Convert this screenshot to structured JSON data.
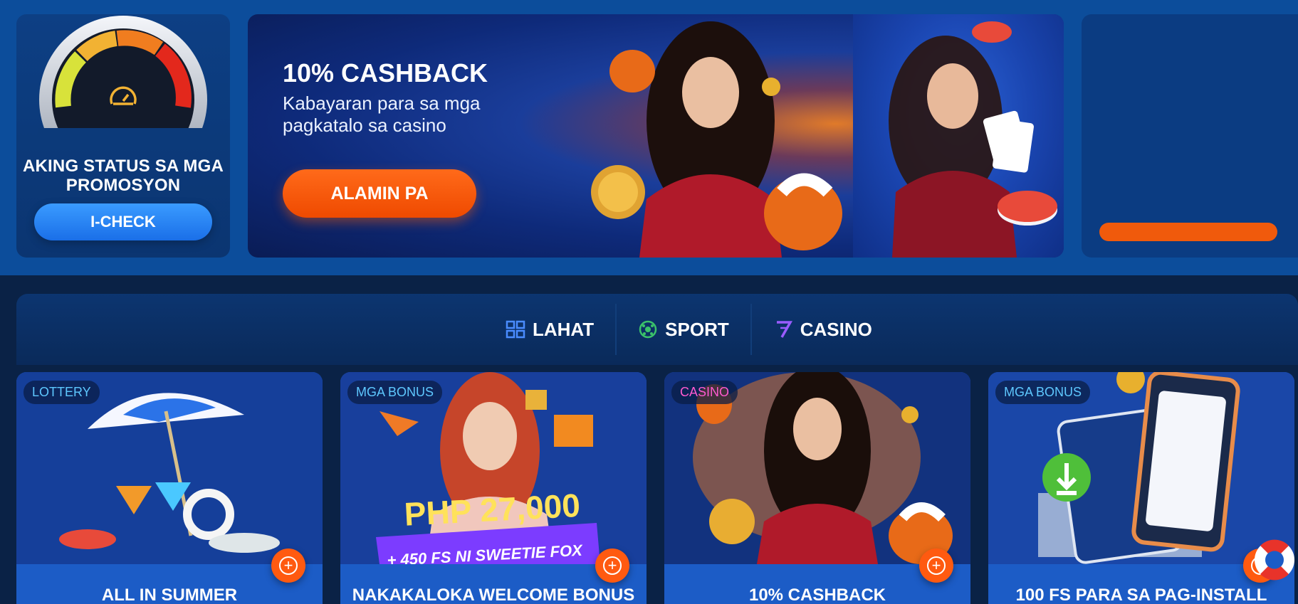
{
  "status_card": {
    "title": "AKING STATUS SA MGA PROMOSYON",
    "button_label": "I-CHECK"
  },
  "hero": {
    "title": "10% CASHBACK",
    "subtitle": "Kabayaran para sa mga pagkatalo sa casino",
    "button_label": "ALAMIN PA"
  },
  "tabs": [
    {
      "label": "LAHAT",
      "icon": "grid-icon"
    },
    {
      "label": "SPORT",
      "icon": "soccer-ball-icon"
    },
    {
      "label": "CASINO",
      "icon": "casino-7-icon"
    }
  ],
  "promos": [
    {
      "badge": "LOTTERY",
      "title": "ALL IN SUMMER"
    },
    {
      "badge": "MGA BONUS",
      "title": "NAKAKALOKA WELCOME BONUS",
      "art_text_1": "PHP 27,000",
      "art_text_2": "+ 450 FS NI SWEETIE FOX"
    },
    {
      "badge": "CASINO",
      "title": "10% CASHBACK"
    },
    {
      "badge": "MGA BONUS",
      "title": "100 FS PARA SA PAG-INSTALL"
    }
  ],
  "colors": {
    "accent_orange": "#ff5a10",
    "primary_blue": "#1a6fe8",
    "background": "#0a2246",
    "top_band": "#0c4d9b"
  }
}
